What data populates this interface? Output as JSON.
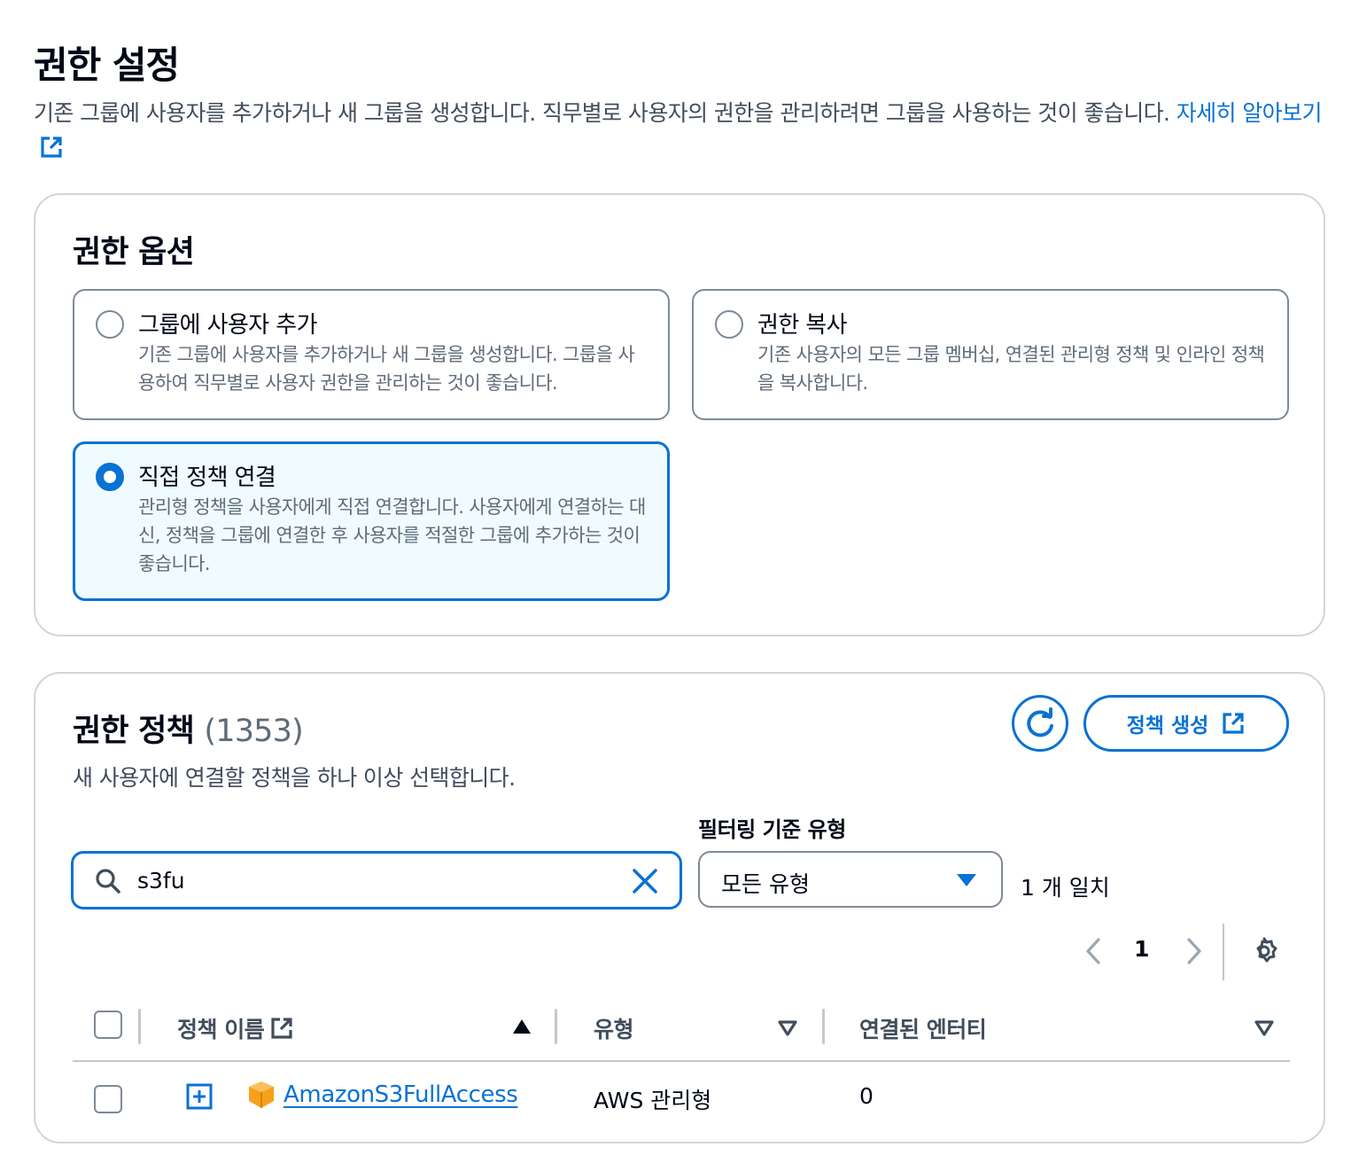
{
  "page": {
    "title": "권한 설정",
    "description": "기존 그룹에 사용자를 추가하거나 새 그룹을 생성합니다. 직무별로 사용자의 권한을 관리하려면 그룹을 사용하는 것이 좋습니다.",
    "learn_more": "자세히 알아보기"
  },
  "options": {
    "title": "권한 옵션",
    "tiles": [
      {
        "label": "그룹에 사용자 추가",
        "desc": "기존 그룹에 사용자를 추가하거나 새 그룹을 생성합니다. 그룹을 사용하여 직무별로 사용자 권한을 관리하는 것이 좋습니다.",
        "selected": false
      },
      {
        "label": "권한 복사",
        "desc": "기존 사용자의 모든 그룹 멤버십, 연결된 관리형 정책 및 인라인 정책을 복사합니다.",
        "selected": false
      },
      {
        "label": "직접 정책 연결",
        "desc": "관리형 정책을 사용자에게 직접 연결합니다. 사용자에게 연결하는 대신, 정책을 그룹에 연결한 후 사용자를 적절한 그룹에 추가하는 것이 좋습니다.",
        "selected": true
      }
    ]
  },
  "policies": {
    "title": "권한 정책",
    "count": "(1353)",
    "description": "새 사용자에 연결할 정책을 하나 이상 선택합니다.",
    "create_button": "정책 생성",
    "filter_label": "필터링 기준 유형",
    "search_value": "s3fu",
    "filter_value": "모든 유형",
    "match_text": "1 개 일치",
    "page_number": "1",
    "columns": [
      "정책 이름",
      "유형",
      "연결된 엔터티"
    ],
    "rows": [
      {
        "name": "AmazonS3FullAccess",
        "type": "AWS 관리형",
        "entities": "0"
      }
    ]
  },
  "colors": {
    "accent": "#0972d3",
    "selected_bg": "#f0fbff",
    "aws_orange": "#f7a11a"
  }
}
